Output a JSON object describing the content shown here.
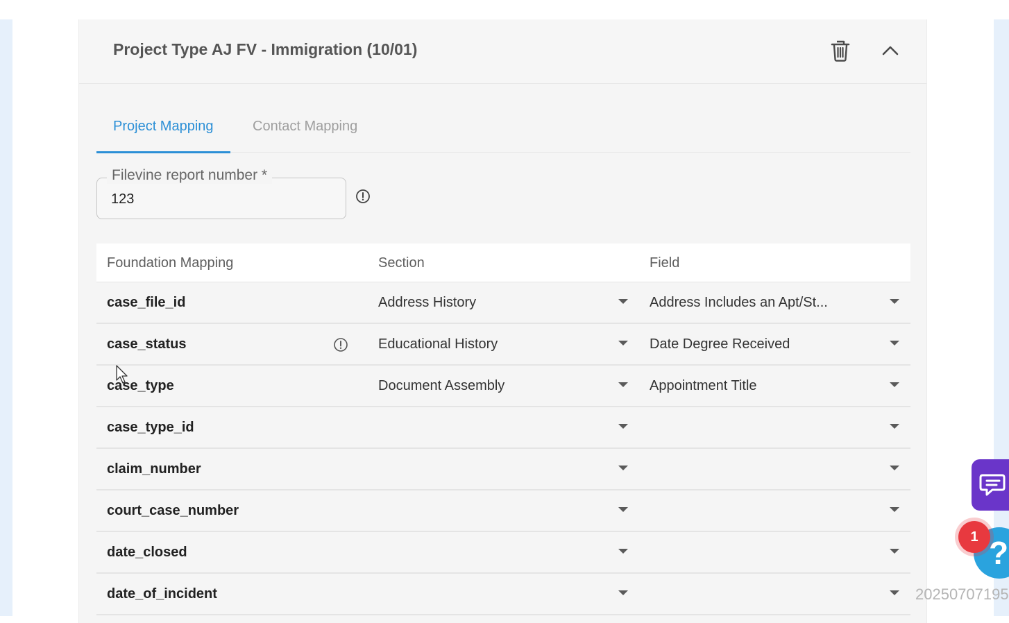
{
  "header": {
    "title": "Project Type AJ FV - Immigration (10/01)",
    "delete_icon": "trash-icon",
    "collapse_icon": "chevron-up-icon"
  },
  "tabs": [
    {
      "label": "Project Mapping",
      "active": true
    },
    {
      "label": "Contact Mapping",
      "active": false
    }
  ],
  "report_field": {
    "label": "Filevine report number *",
    "value": "123",
    "info_icon": "info-icon"
  },
  "table": {
    "columns": [
      "Foundation Mapping",
      "Section",
      "Field"
    ],
    "rows": [
      {
        "key": "case_file_id",
        "section": "Address History",
        "field": "Address Includes an Apt/St..."
      },
      {
        "key": "case_status",
        "section": "Educational History",
        "field": "Date Degree Received"
      },
      {
        "key": "case_type",
        "section": "Document Assembly",
        "field": "Appointment Title"
      },
      {
        "key": "case_type_id",
        "section": "",
        "field": ""
      },
      {
        "key": "claim_number",
        "section": "",
        "field": ""
      },
      {
        "key": "court_case_number",
        "section": "",
        "field": ""
      },
      {
        "key": "date_closed",
        "section": "",
        "field": ""
      },
      {
        "key": "date_of_incident",
        "section": "",
        "field": ""
      }
    ]
  },
  "widgets": {
    "chat_icon": "chat-icon",
    "help_label": "?",
    "notification_count": "1"
  },
  "watermark": "20250707195",
  "colors": {
    "accent": "#2b8fd6",
    "chat": "#6a35c9",
    "help": "#2aa3de",
    "badge": "#e8393f"
  }
}
